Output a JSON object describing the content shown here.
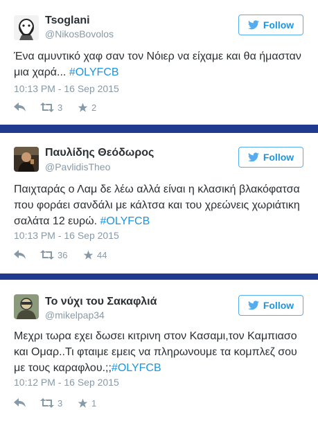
{
  "tweets": [
    {
      "name": "Tsoglani",
      "handle": "@NikosBovolos",
      "follow_label": "Follow",
      "text": "Ένα αμυντικό χαφ σαν τον Νόιερ να είχαμε και θα ήμασταν μια χαρά... ",
      "hashtag": "#OLYFCB",
      "timestamp": "10:13 PM - 16 Sep 2015",
      "retweets": "3",
      "likes": "2"
    },
    {
      "name": "Παυλίδης Θεόδωρος",
      "handle": "@PavlidisTheo",
      "follow_label": "Follow",
      "text": "Παιχταράς ο Λαμ δε λέω αλλά είναι η κλασική βλακόφατσα που φοράει σανδάλι με κάλτσα και του χρεώνεις χωριάτικη σαλάτα 12 ευρώ. ",
      "hashtag": "#OLYFCB",
      "timestamp": "10:13 PM - 16 Sep 2015",
      "retweets": "36",
      "likes": "44"
    },
    {
      "name": "Το νύχι του Σακαφλιά",
      "handle": "@mikelpap34",
      "follow_label": "Follow",
      "text": "Μεχρι τωρα εχει δωσει κιτρινη στον Κασαμι,τον Καμπιασο και Ομαρ..Τι φταιμε εμεις να πληρωνουμε τα κομπλεζ σου με τους καραφλου.;;",
      "hashtag": "#OLYFCB",
      "timestamp": "10:12 PM - 16 Sep 2015",
      "retweets": "3",
      "likes": "1"
    }
  ],
  "colors": {
    "background": "#1f3a8f",
    "card": "#ffffff",
    "link": "#1b95e0",
    "muted": "#8899a6",
    "text": "#292f33"
  },
  "icons": [
    "twitter-bird-icon",
    "reply-icon",
    "retweet-icon",
    "like-star-icon"
  ]
}
